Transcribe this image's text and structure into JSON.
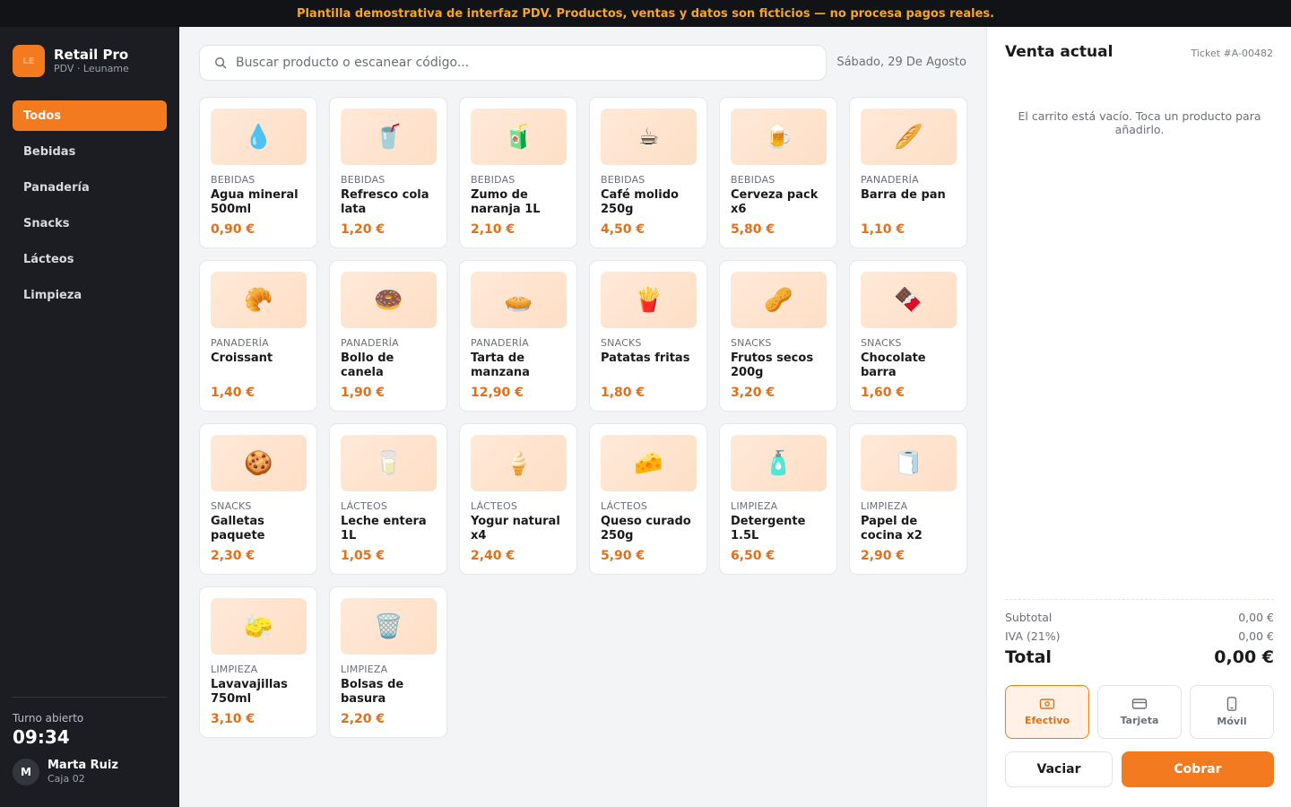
{
  "banner": "Plantilla demostrativa de interfaz PDV. Productos, ventas y datos son ficticios — no procesa pagos reales.",
  "brand": {
    "logo": "LE",
    "name": "Retail Pro",
    "subtitle": "PDV · Leuname"
  },
  "categories": [
    "Todos",
    "Bebidas",
    "Panadería",
    "Snacks",
    "Lácteos",
    "Limpieza"
  ],
  "active_category": "Todos",
  "shift": {
    "label": "Turno abierto",
    "time": "09:34"
  },
  "user": {
    "initial": "M",
    "name": "Marta Ruiz",
    "register": "Caja 02"
  },
  "search": {
    "placeholder": "Buscar producto o escanear código..."
  },
  "date": "Sábado, 29 De Agosto",
  "products": [
    {
      "category": "BEBIDAS",
      "name": "Agua mineral 500ml",
      "price": "0,90 €",
      "icon": "💧"
    },
    {
      "category": "BEBIDAS",
      "name": "Refresco cola lata",
      "price": "1,20 €",
      "icon": "🥤"
    },
    {
      "category": "BEBIDAS",
      "name": "Zumo de naranja 1L",
      "price": "2,10 €",
      "icon": "🧃"
    },
    {
      "category": "BEBIDAS",
      "name": "Café molido 250g",
      "price": "4,50 €",
      "icon": "☕"
    },
    {
      "category": "BEBIDAS",
      "name": "Cerveza pack x6",
      "price": "5,80 €",
      "icon": "🍺"
    },
    {
      "category": "PANADERÍA",
      "name": "Barra de pan",
      "price": "1,10 €",
      "icon": "🥖"
    },
    {
      "category": "PANADERÍA",
      "name": "Croissant",
      "price": "1,40 €",
      "icon": "🥐"
    },
    {
      "category": "PANADERÍA",
      "name": "Bollo de canela",
      "price": "1,90 €",
      "icon": "🍩"
    },
    {
      "category": "PANADERÍA",
      "name": "Tarta de manzana",
      "price": "12,90 €",
      "icon": "🥧"
    },
    {
      "category": "SNACKS",
      "name": "Patatas fritas",
      "price": "1,80 €",
      "icon": "🍟"
    },
    {
      "category": "SNACKS",
      "name": "Frutos secos 200g",
      "price": "3,20 €",
      "icon": "🥜"
    },
    {
      "category": "SNACKS",
      "name": "Chocolate barra",
      "price": "1,60 €",
      "icon": "🍫"
    },
    {
      "category": "SNACKS",
      "name": "Galletas paquete",
      "price": "2,30 €",
      "icon": "🍪"
    },
    {
      "category": "LÁCTEOS",
      "name": "Leche entera 1L",
      "price": "1,05 €",
      "icon": "🥛"
    },
    {
      "category": "LÁCTEOS",
      "name": "Yogur natural x4",
      "price": "2,40 €",
      "icon": "🍦"
    },
    {
      "category": "LÁCTEOS",
      "name": "Queso curado 250g",
      "price": "5,90 €",
      "icon": "🧀"
    },
    {
      "category": "LIMPIEZA",
      "name": "Detergente 1.5L",
      "price": "6,50 €",
      "icon": "🧴"
    },
    {
      "category": "LIMPIEZA",
      "name": "Papel de cocina x2",
      "price": "2,90 €",
      "icon": "🧻"
    },
    {
      "category": "LIMPIEZA",
      "name": "Lavavajillas 750ml",
      "price": "3,10 €",
      "icon": "🧽"
    },
    {
      "category": "LIMPIEZA",
      "name": "Bolsas de basura",
      "price": "2,20 €",
      "icon": "🗑️"
    }
  ],
  "cart": {
    "title": "Venta actual",
    "ticket": "Ticket #A-00482",
    "empty_message": "El carrito está vacío. Toca un producto para añadirlo.",
    "subtotal_label": "Subtotal",
    "subtotal": "0,00 €",
    "tax_label": "IVA (21%)",
    "tax": "0,00 €",
    "total_label": "Total",
    "total": "0,00 €",
    "payment_methods": [
      {
        "label": "Efectivo",
        "icon": "cash-icon",
        "active": true
      },
      {
        "label": "Tarjeta",
        "icon": "card-icon",
        "active": false
      },
      {
        "label": "Móvil",
        "icon": "mobile-icon",
        "active": false
      }
    ],
    "clear_label": "Vaciar",
    "charge_label": "Cobrar"
  },
  "colors": {
    "accent": "#f47a20",
    "sidebar": "#1c1d23",
    "banner_text": "#f5a623",
    "price": "#e0701a"
  }
}
